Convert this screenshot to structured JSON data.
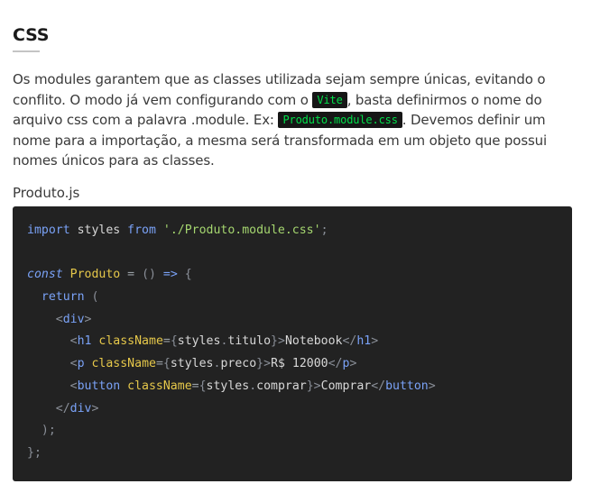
{
  "section": {
    "title": "CSS",
    "paragraph": {
      "part1": "Os modules garantem que as classes utilizada sejam sempre únicas, evitando o conflito. O modo já vem configurando com o ",
      "code1": "Vite",
      "part2": ", basta definirmos o nome do arquivo css com a palavra .module. Ex: ",
      "code2": "Produto.module.css",
      "part3": ". Devemos definir um nome para a importação, a mesma será transformada em um objeto que possui nomes únicos para as classes."
    },
    "filename": "Produto.js"
  },
  "code": {
    "l1": {
      "import": "import",
      "styles": " styles ",
      "from": "from",
      "path": "'./Produto.module.css'",
      "semi": ";"
    },
    "l3": {
      "const": "const",
      "name": " Produto ",
      "eq": "=",
      "parens": " () ",
      "arrow": "=>",
      "brace": " {"
    },
    "l4": {
      "return": "return",
      "paren": " ("
    },
    "l5": {
      "open": "<",
      "tag": "div",
      "close": ">"
    },
    "l6": {
      "open": "<",
      "tag": "h1",
      "attr": " className",
      "eq": "=",
      "lb": "{",
      "expr": "styles",
      "dot": ".",
      "prop": "titulo",
      "rb": "}",
      "gt": ">",
      "text": "Notebook",
      "endopen": "</",
      "endtag": "h1",
      "endgt": ">"
    },
    "l7": {
      "open": "<",
      "tag": "p",
      "attr": " className",
      "eq": "=",
      "lb": "{",
      "expr": "styles",
      "dot": ".",
      "prop": "preco",
      "rb": "}",
      "gt": ">",
      "text": "R$ 12000",
      "endopen": "</",
      "endtag": "p",
      "endgt": ">"
    },
    "l8": {
      "open": "<",
      "tag": "button",
      "attr": " className",
      "eq": "=",
      "lb": "{",
      "expr": "styles",
      "dot": ".",
      "prop": "comprar",
      "rb": "}",
      "gt": ">",
      "text": "Comprar",
      "endopen": "</",
      "endtag": "button",
      "endgt": ">"
    },
    "l9": {
      "open": "</",
      "tag": "div",
      "close": ">"
    },
    "l10": {
      "paren": ");"
    },
    "l11": {
      "brace": "};"
    }
  }
}
